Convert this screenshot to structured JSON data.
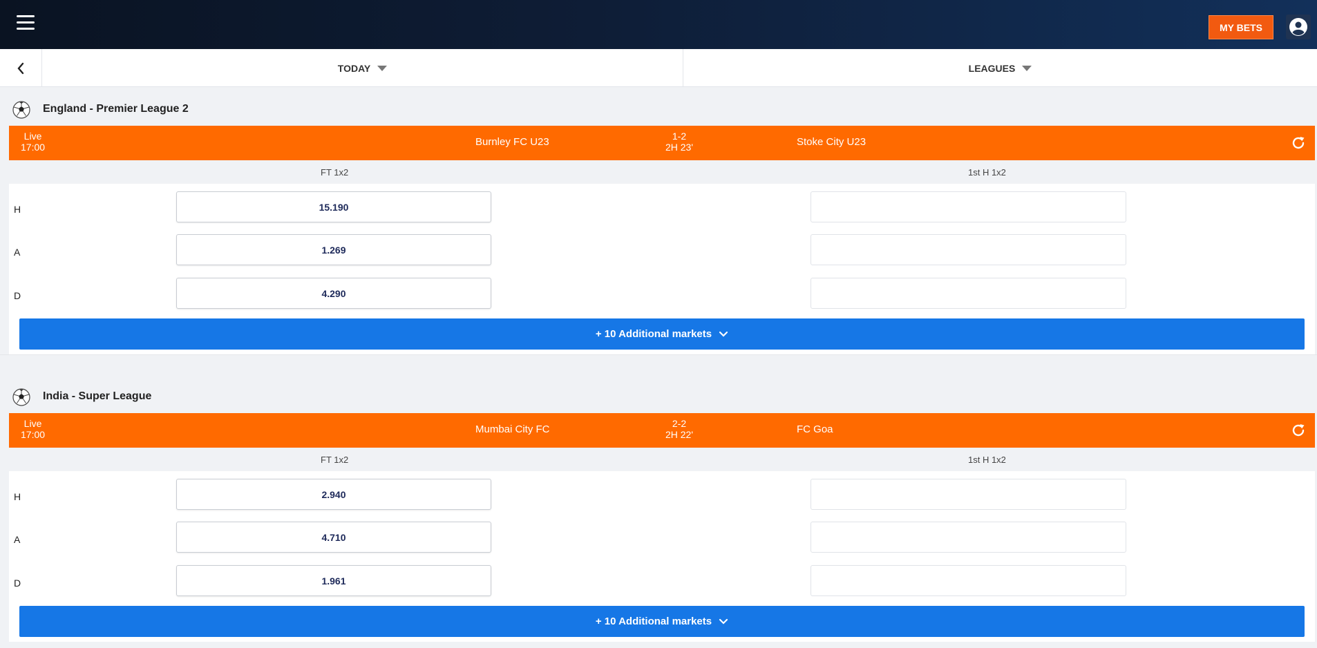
{
  "header": {
    "my_bets_label": "MY BETS"
  },
  "filters": {
    "today_label": "TODAY",
    "leagues_label": "LEAGUES"
  },
  "colors": {
    "accent_orange": "#ff6a00",
    "button_blue": "#1677e6"
  },
  "leagues": [
    {
      "name": "England - Premier League 2",
      "match": {
        "status": "Live",
        "time": "17:00",
        "home": "Burnley FC U23",
        "score": "1-2",
        "clock": "2H 23'",
        "away": "Stoke City U23"
      },
      "markets": [
        "FT 1x2",
        "1st H 1x2"
      ],
      "rows": [
        {
          "label": "H",
          "ft": "15.190",
          "first_half": ""
        },
        {
          "label": "A",
          "ft": "1.269",
          "first_half": ""
        },
        {
          "label": "D",
          "ft": "4.290",
          "first_half": ""
        }
      ],
      "additional_markets_label": "+ 10 Additional markets"
    },
    {
      "name": "India - Super League",
      "match": {
        "status": "Live",
        "time": "17:00",
        "home": "Mumbai City FC",
        "score": "2-2",
        "clock": "2H 22'",
        "away": "FC Goa"
      },
      "markets": [
        "FT 1x2",
        "1st H 1x2"
      ],
      "rows": [
        {
          "label": "H",
          "ft": "2.940",
          "first_half": ""
        },
        {
          "label": "A",
          "ft": "4.710",
          "first_half": ""
        },
        {
          "label": "D",
          "ft": "1.961",
          "first_half": ""
        }
      ],
      "additional_markets_label": "+ 10 Additional markets"
    }
  ]
}
